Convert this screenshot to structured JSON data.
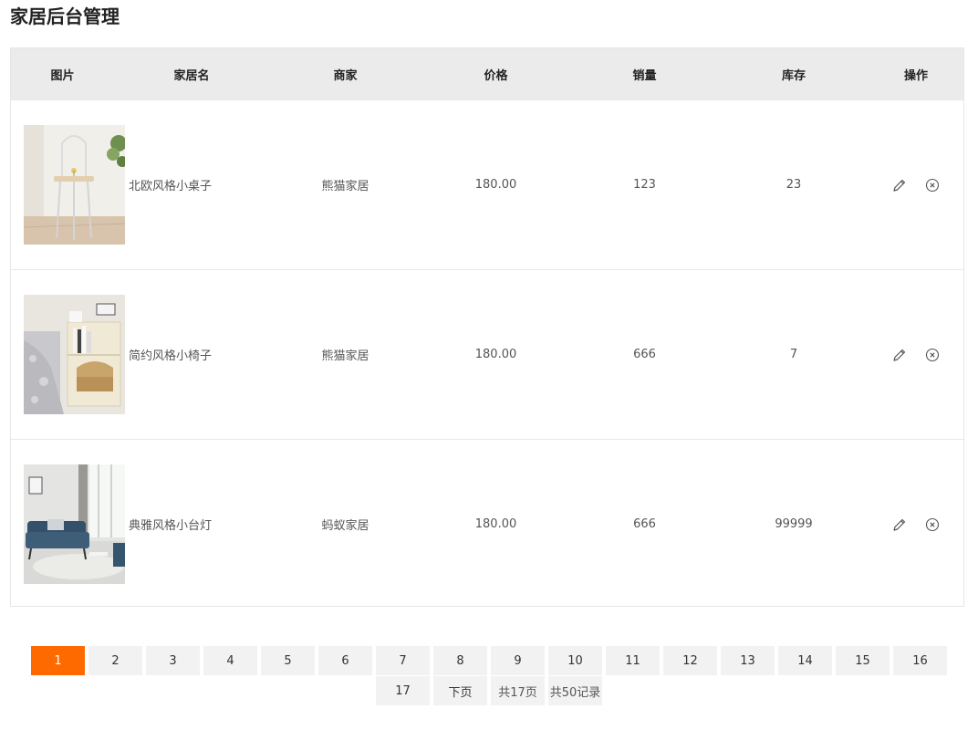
{
  "page": {
    "title": "家居后台管理"
  },
  "table": {
    "headers": [
      "图片",
      "家居名",
      "商家",
      "价格",
      "销量",
      "库存",
      "操作"
    ],
    "rows": [
      {
        "name": "北欧风格小桌子",
        "vendor": "熊猫家居",
        "price": "180.00",
        "sales": "123",
        "stock": "23"
      },
      {
        "name": "简约风格小椅子",
        "vendor": "熊猫家居",
        "price": "180.00",
        "sales": "666",
        "stock": "7"
      },
      {
        "name": "典雅风格小台灯",
        "vendor": "蚂蚁家居",
        "price": "180.00",
        "sales": "666",
        "stock": "99999"
      }
    ]
  },
  "icons": {
    "edit": "pencil-icon",
    "delete": "circle-x-icon"
  },
  "pagination": {
    "pages": [
      "1",
      "2",
      "3",
      "4",
      "5",
      "6",
      "7",
      "8",
      "9",
      "10",
      "11",
      "12",
      "13",
      "14",
      "15",
      "16",
      "17"
    ],
    "current": "1",
    "next_label": "下页",
    "total_pages_text": "共17页",
    "total_records_text": "共50记录"
  },
  "colors": {
    "accent": "#ff6a00",
    "header_bg": "#ebebeb",
    "pager_bg": "#f2f2f2"
  }
}
